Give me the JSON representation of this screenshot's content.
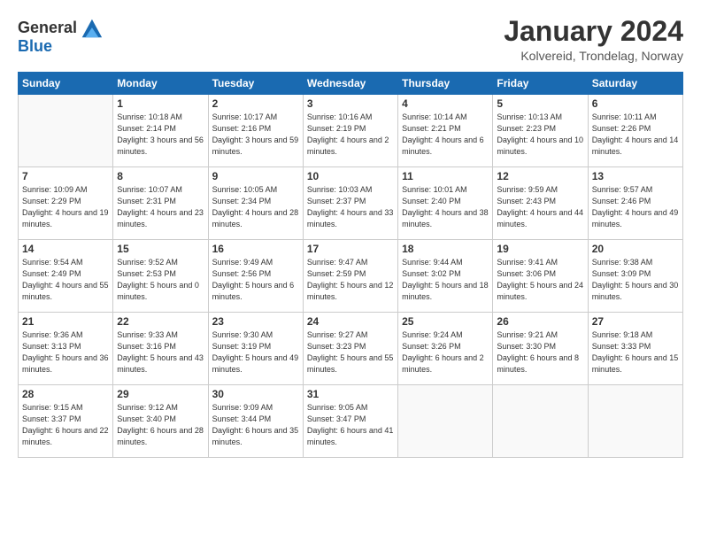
{
  "header": {
    "logo_general": "General",
    "logo_blue": "Blue",
    "month_year": "January 2024",
    "location": "Kolvereid, Trondelag, Norway"
  },
  "days_of_week": [
    "Sunday",
    "Monday",
    "Tuesday",
    "Wednesday",
    "Thursday",
    "Friday",
    "Saturday"
  ],
  "weeks": [
    [
      {
        "day": "",
        "sunrise": "",
        "sunset": "",
        "daylight": ""
      },
      {
        "day": "1",
        "sunrise": "Sunrise: 10:18 AM",
        "sunset": "Sunset: 2:14 PM",
        "daylight": "Daylight: 3 hours and 56 minutes."
      },
      {
        "day": "2",
        "sunrise": "Sunrise: 10:17 AM",
        "sunset": "Sunset: 2:16 PM",
        "daylight": "Daylight: 3 hours and 59 minutes."
      },
      {
        "day": "3",
        "sunrise": "Sunrise: 10:16 AM",
        "sunset": "Sunset: 2:19 PM",
        "daylight": "Daylight: 4 hours and 2 minutes."
      },
      {
        "day": "4",
        "sunrise": "Sunrise: 10:14 AM",
        "sunset": "Sunset: 2:21 PM",
        "daylight": "Daylight: 4 hours and 6 minutes."
      },
      {
        "day": "5",
        "sunrise": "Sunrise: 10:13 AM",
        "sunset": "Sunset: 2:23 PM",
        "daylight": "Daylight: 4 hours and 10 minutes."
      },
      {
        "day": "6",
        "sunrise": "Sunrise: 10:11 AM",
        "sunset": "Sunset: 2:26 PM",
        "daylight": "Daylight: 4 hours and 14 minutes."
      }
    ],
    [
      {
        "day": "7",
        "sunrise": "Sunrise: 10:09 AM",
        "sunset": "Sunset: 2:29 PM",
        "daylight": "Daylight: 4 hours and 19 minutes."
      },
      {
        "day": "8",
        "sunrise": "Sunrise: 10:07 AM",
        "sunset": "Sunset: 2:31 PM",
        "daylight": "Daylight: 4 hours and 23 minutes."
      },
      {
        "day": "9",
        "sunrise": "Sunrise: 10:05 AM",
        "sunset": "Sunset: 2:34 PM",
        "daylight": "Daylight: 4 hours and 28 minutes."
      },
      {
        "day": "10",
        "sunrise": "Sunrise: 10:03 AM",
        "sunset": "Sunset: 2:37 PM",
        "daylight": "Daylight: 4 hours and 33 minutes."
      },
      {
        "day": "11",
        "sunrise": "Sunrise: 10:01 AM",
        "sunset": "Sunset: 2:40 PM",
        "daylight": "Daylight: 4 hours and 38 minutes."
      },
      {
        "day": "12",
        "sunrise": "Sunrise: 9:59 AM",
        "sunset": "Sunset: 2:43 PM",
        "daylight": "Daylight: 4 hours and 44 minutes."
      },
      {
        "day": "13",
        "sunrise": "Sunrise: 9:57 AM",
        "sunset": "Sunset: 2:46 PM",
        "daylight": "Daylight: 4 hours and 49 minutes."
      }
    ],
    [
      {
        "day": "14",
        "sunrise": "Sunrise: 9:54 AM",
        "sunset": "Sunset: 2:49 PM",
        "daylight": "Daylight: 4 hours and 55 minutes."
      },
      {
        "day": "15",
        "sunrise": "Sunrise: 9:52 AM",
        "sunset": "Sunset: 2:53 PM",
        "daylight": "Daylight: 5 hours and 0 minutes."
      },
      {
        "day": "16",
        "sunrise": "Sunrise: 9:49 AM",
        "sunset": "Sunset: 2:56 PM",
        "daylight": "Daylight: 5 hours and 6 minutes."
      },
      {
        "day": "17",
        "sunrise": "Sunrise: 9:47 AM",
        "sunset": "Sunset: 2:59 PM",
        "daylight": "Daylight: 5 hours and 12 minutes."
      },
      {
        "day": "18",
        "sunrise": "Sunrise: 9:44 AM",
        "sunset": "Sunset: 3:02 PM",
        "daylight": "Daylight: 5 hours and 18 minutes."
      },
      {
        "day": "19",
        "sunrise": "Sunrise: 9:41 AM",
        "sunset": "Sunset: 3:06 PM",
        "daylight": "Daylight: 5 hours and 24 minutes."
      },
      {
        "day": "20",
        "sunrise": "Sunrise: 9:38 AM",
        "sunset": "Sunset: 3:09 PM",
        "daylight": "Daylight: 5 hours and 30 minutes."
      }
    ],
    [
      {
        "day": "21",
        "sunrise": "Sunrise: 9:36 AM",
        "sunset": "Sunset: 3:13 PM",
        "daylight": "Daylight: 5 hours and 36 minutes."
      },
      {
        "day": "22",
        "sunrise": "Sunrise: 9:33 AM",
        "sunset": "Sunset: 3:16 PM",
        "daylight": "Daylight: 5 hours and 43 minutes."
      },
      {
        "day": "23",
        "sunrise": "Sunrise: 9:30 AM",
        "sunset": "Sunset: 3:19 PM",
        "daylight": "Daylight: 5 hours and 49 minutes."
      },
      {
        "day": "24",
        "sunrise": "Sunrise: 9:27 AM",
        "sunset": "Sunset: 3:23 PM",
        "daylight": "Daylight: 5 hours and 55 minutes."
      },
      {
        "day": "25",
        "sunrise": "Sunrise: 9:24 AM",
        "sunset": "Sunset: 3:26 PM",
        "daylight": "Daylight: 6 hours and 2 minutes."
      },
      {
        "day": "26",
        "sunrise": "Sunrise: 9:21 AM",
        "sunset": "Sunset: 3:30 PM",
        "daylight": "Daylight: 6 hours and 8 minutes."
      },
      {
        "day": "27",
        "sunrise": "Sunrise: 9:18 AM",
        "sunset": "Sunset: 3:33 PM",
        "daylight": "Daylight: 6 hours and 15 minutes."
      }
    ],
    [
      {
        "day": "28",
        "sunrise": "Sunrise: 9:15 AM",
        "sunset": "Sunset: 3:37 PM",
        "daylight": "Daylight: 6 hours and 22 minutes."
      },
      {
        "day": "29",
        "sunrise": "Sunrise: 9:12 AM",
        "sunset": "Sunset: 3:40 PM",
        "daylight": "Daylight: 6 hours and 28 minutes."
      },
      {
        "day": "30",
        "sunrise": "Sunrise: 9:09 AM",
        "sunset": "Sunset: 3:44 PM",
        "daylight": "Daylight: 6 hours and 35 minutes."
      },
      {
        "day": "31",
        "sunrise": "Sunrise: 9:05 AM",
        "sunset": "Sunset: 3:47 PM",
        "daylight": "Daylight: 6 hours and 41 minutes."
      },
      {
        "day": "",
        "sunrise": "",
        "sunset": "",
        "daylight": ""
      },
      {
        "day": "",
        "sunrise": "",
        "sunset": "",
        "daylight": ""
      },
      {
        "day": "",
        "sunrise": "",
        "sunset": "",
        "daylight": ""
      }
    ]
  ]
}
